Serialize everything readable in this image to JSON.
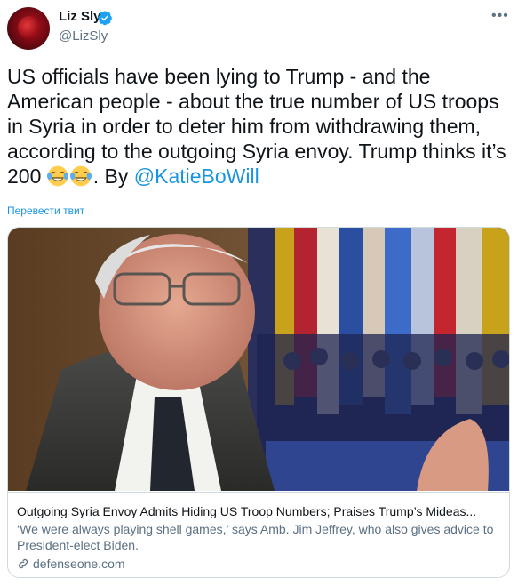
{
  "author": {
    "name": "Liz Sly",
    "handle": "@LizSly"
  },
  "tweet": {
    "text_main": "US officials have been lying to Trump - and the American people - about the true number of US troops in Syria in order to deter him from withdrawing them, according to the outgoing Syria envoy. Trump thinks it’s 200 ",
    "text_after_emoji": ". By ",
    "mention": "@KatieBoWill",
    "emoji_names": [
      "tears-of-joy-emoji",
      "tears-of-joy-emoji"
    ],
    "translate_label": "Перевести твит"
  },
  "card": {
    "title": "Outgoing Syria Envoy Admits Hiding US Troop Numbers; Praises Trump’s Mideas...",
    "description": "‘We were always playing shell games,’ says Amb. Jim Jeffrey, who also gives advice to President-elect Biden.",
    "domain": "defenseone.com"
  },
  "colors": {
    "link": "#1b95e0",
    "secondary_text": "#5b7083",
    "verified": "#1da1f2",
    "border": "#cfd9de"
  }
}
